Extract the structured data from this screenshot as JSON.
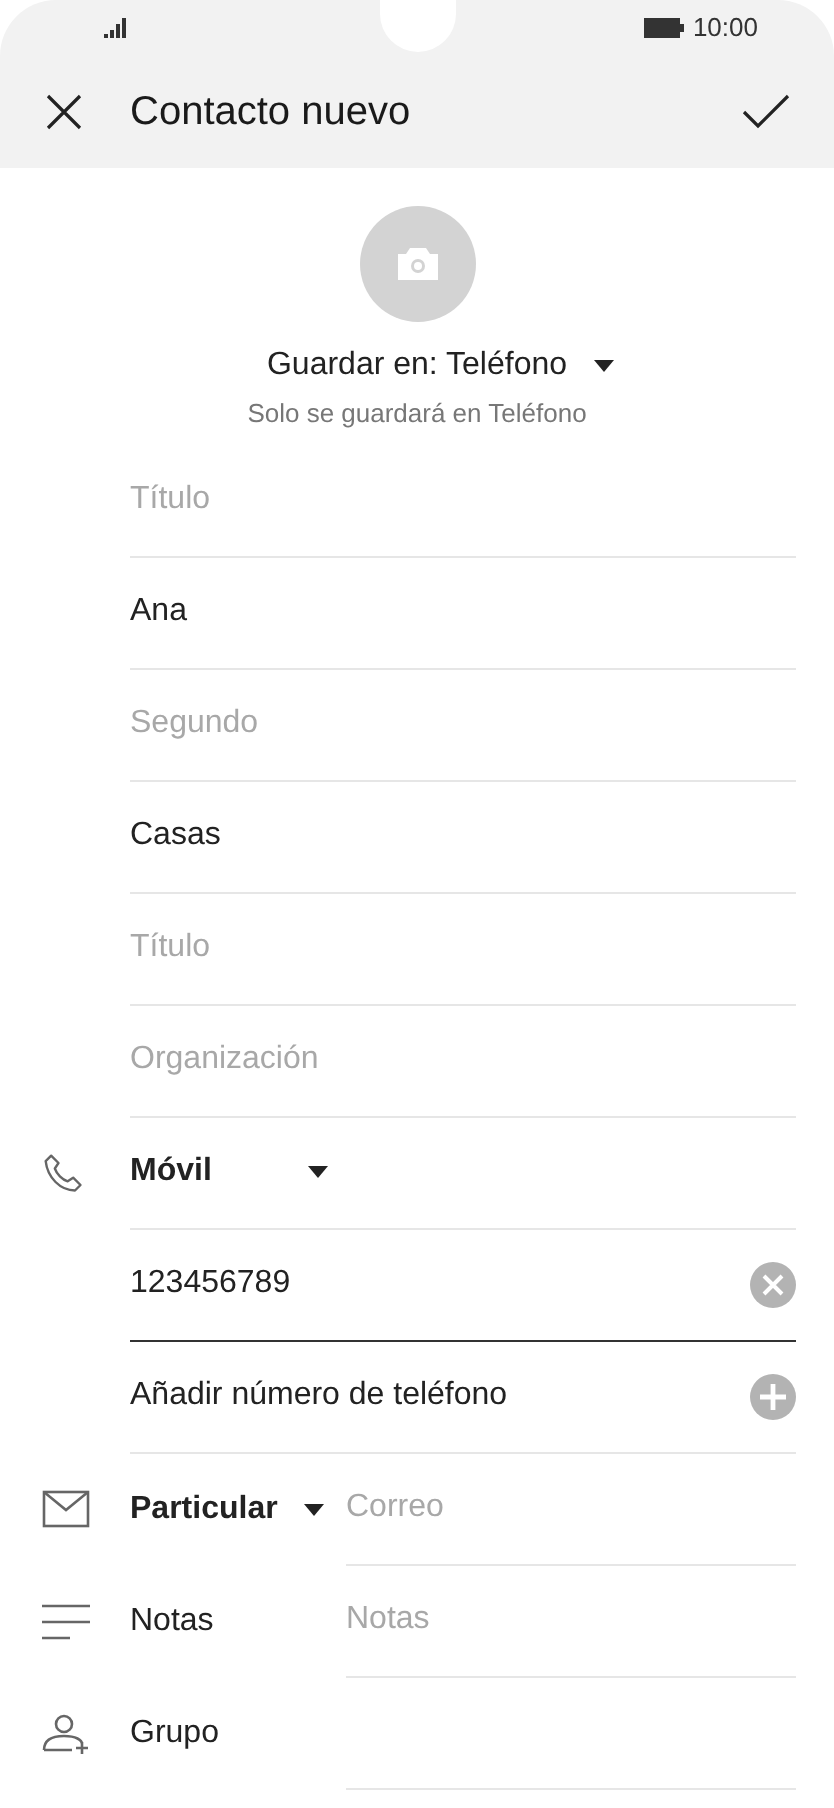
{
  "status_bar": {
    "time": "10:00"
  },
  "header": {
    "title": "Contacto nuevo"
  },
  "storage": {
    "label": "Guardar en: Teléfono",
    "note": "Solo se guardará en Teléfono"
  },
  "name_fields": [
    {
      "placeholder": "Título"
    },
    {
      "value": "Ana"
    },
    {
      "placeholder": "Segundo"
    },
    {
      "value": "Casas"
    },
    {
      "placeholder": "Título"
    },
    {
      "placeholder": "Organización"
    }
  ],
  "phone": {
    "type": "Móvil",
    "value": "123456789",
    "focused": true,
    "add_label": "Añadir número de teléfono"
  },
  "email": {
    "type": "Particular",
    "placeholder": "Correo"
  },
  "notes": {
    "label": "Notas",
    "placeholder": "Notas"
  },
  "group": {
    "label": "Grupo"
  }
}
